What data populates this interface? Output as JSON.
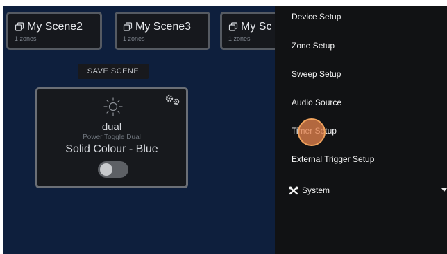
{
  "scenes": [
    {
      "name": "My Scene2",
      "zones": "1 zones"
    },
    {
      "name": "My Scene3",
      "zones": "1 zones"
    },
    {
      "name": "My Sc",
      "zones": "1 zones"
    }
  ],
  "save_scene_label": "SAVE SCENE",
  "zone_card": {
    "name": "dual",
    "type": "Power Toggle Dual",
    "effect": "Solid Colour - Blue",
    "toggle_on": false,
    "icon": "sun-icon",
    "settings_icon": "gears-icon"
  },
  "menu": {
    "items": [
      "Device Setup",
      "Zone Setup",
      "Sweep Setup",
      "Audio Source",
      "Timer Setup",
      "External Trigger Setup"
    ],
    "system_label": "System",
    "system_icon": "tools-icon"
  },
  "colors": {
    "main_bg": "#0e1f3d",
    "menu_bg": "#111214",
    "cursor": "#e2804b"
  }
}
